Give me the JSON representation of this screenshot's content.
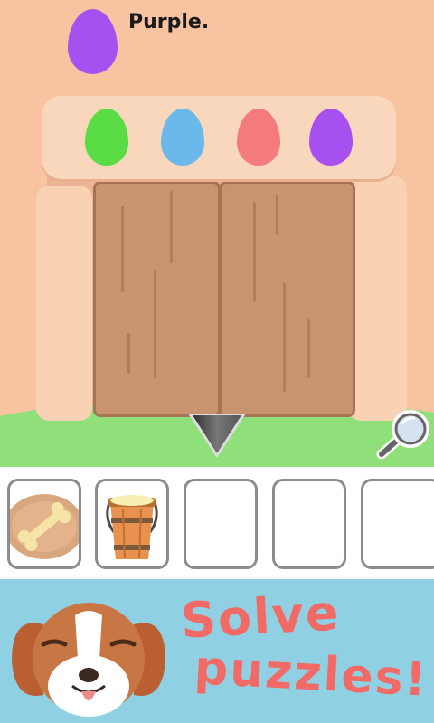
{
  "hint": {
    "egg_color": "#a651ef",
    "text": "Purple."
  },
  "eggs": [
    {
      "name": "green",
      "color": "#5add44"
    },
    {
      "name": "blue",
      "color": "#6bb8eb"
    },
    {
      "name": "red",
      "color": "#f47b7b"
    },
    {
      "name": "purple",
      "color": "#a651ef"
    }
  ],
  "controls": {
    "back_icon": "down-arrow-icon",
    "zoom_icon": "magnifier-icon"
  },
  "inventory": {
    "slots": [
      {
        "item": "bone-on-plate"
      },
      {
        "item": "wooden-bucket"
      },
      {
        "item": ""
      },
      {
        "item": ""
      },
      {
        "item": ""
      }
    ]
  },
  "banner": {
    "line1": "Solve",
    "line2": "puzzles!"
  }
}
